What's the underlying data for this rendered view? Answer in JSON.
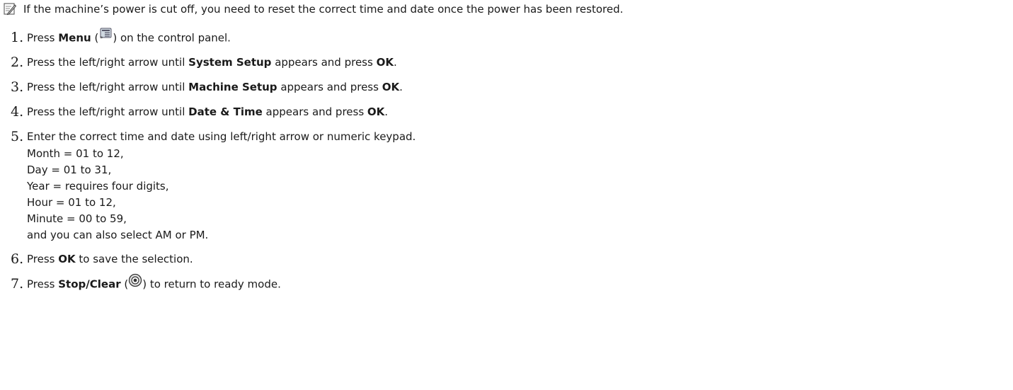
{
  "note": {
    "icon": "note-pencil-icon",
    "text": "If the machine’s power is cut off, you need to reset the correct time and date once the power has been restored."
  },
  "steps": [
    {
      "num": "1.",
      "pre": "Press ",
      "bold1": "Menu",
      "mid1": " (",
      "icon": "menu-button-icon",
      "post": ") on the control panel."
    },
    {
      "num": "2.",
      "pre": "Press the left/right arrow until ",
      "bold1": "System Setup",
      "mid1": " appears and press ",
      "bold2": "OK",
      "post": "."
    },
    {
      "num": "3.",
      "pre": "Press the left/right arrow until ",
      "bold1": "Machine Setup",
      "mid1": " appears and press ",
      "bold2": "OK",
      "post": "."
    },
    {
      "num": "4.",
      "pre": "Press the left/right arrow until ",
      "bold1": "Date & Time",
      "mid1": " appears and press ",
      "bold2": "OK",
      "post": "."
    },
    {
      "num": "5.",
      "text": "Enter the correct time and date using left/right arrow or numeric keypad.",
      "details": [
        "Month = 01 to 12,",
        "Day = 01 to 31,",
        "Year = requires four digits,",
        "Hour = 01 to 12,",
        "Minute = 00 to 59,",
        "and you can also select AM or PM."
      ]
    },
    {
      "num": "6.",
      "pre": "Press ",
      "bold1": "OK",
      "post": " to save the selection."
    },
    {
      "num": "7.",
      "pre": "Press ",
      "bold1": "Stop/Clear",
      "mid1": " (",
      "icon": "stop-clear-button-icon",
      "post": ") to return to ready mode."
    }
  ]
}
